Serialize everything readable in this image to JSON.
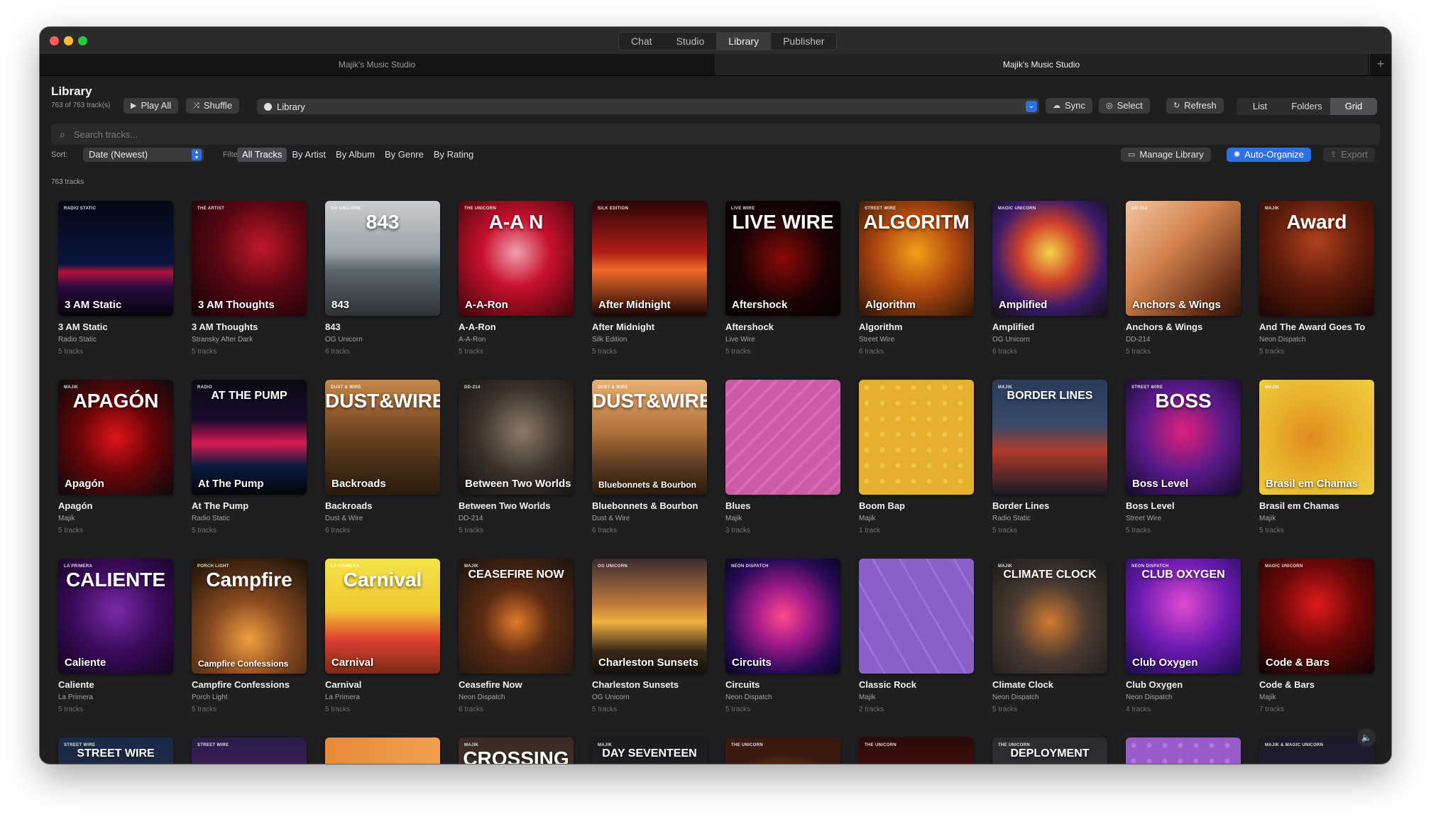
{
  "titlebar": {
    "modes": [
      "Chat",
      "Studio",
      "Library",
      "Publisher"
    ],
    "active_mode": "Library"
  },
  "doc_tabs": [
    "Majik's Music Studio",
    "Majik's Music Studio"
  ],
  "toolbar": {
    "title": "Library",
    "subtitle": "763 of 763 track(s)",
    "play_all": "Play All",
    "shuffle": "Shuffle",
    "library_select": "Library",
    "sync": "Sync",
    "select": "Select",
    "refresh": "Refresh",
    "views": [
      "List",
      "Folders",
      "Grid"
    ],
    "active_view": "Grid"
  },
  "search": {
    "placeholder": "Search tracks..."
  },
  "sort": {
    "label": "Sort:",
    "value": "Date (Newest)",
    "filter_label": "Filter",
    "filters": [
      "All Tracks",
      "By Artist",
      "By Album",
      "By Genre",
      "By Rating"
    ],
    "active_filter": "All Tracks",
    "manage_library": "Manage Library",
    "auto_organize": "Auto-Organize",
    "export": "Export"
  },
  "count_label": "763 tracks",
  "albums": [
    {
      "title": "3 AM Static",
      "artist": "Radio Static",
      "tracks": "5 tracks",
      "overlay": "3 AM Static",
      "label": "RADIO STATIC",
      "bg": "linear-gradient(180deg,#050714 0%,#0a1640 55%,#b0123a 62%,#2a0a40 75%,#05050c 100%)"
    },
    {
      "title": "3 AM Thoughts",
      "artist": "Stransky After Dark",
      "tracks": "5 tracks",
      "overlay": "3 AM Thoughts",
      "label": "THE ARTIST",
      "bg": "radial-gradient(circle at 60% 40%,#c0182a 0%,#5a0712 45%,#120205 100%)"
    },
    {
      "title": "843",
      "artist": "OG Unicorn",
      "tracks": "6 tracks",
      "overlay": "843",
      "label": "OG UNICORN",
      "big": "843",
      "bg": "linear-gradient(180deg,#c9cdd0 0%,#9aa3a8 45%,#5a666e 60%,#2e3236 100%)"
    },
    {
      "title": "A-A-Ron",
      "artist": "A-A-Ron",
      "tracks": "5 tracks",
      "overlay": "A-A-Ron",
      "label": "THE UNICORN",
      "big": "A-A N",
      "bg": "radial-gradient(circle at 50% 45%,#f0a0b0 0%,#c8102e 40%,#3a0608 100%)"
    },
    {
      "title": "After Midnight",
      "artist": "Silk Edition",
      "tracks": "5 tracks",
      "overlay": "After Midnight",
      "label": "SILK EDITION",
      "bg": "linear-gradient(180deg,#2a0408 0%,#b01e14 45%,#f06a2a 60%,#1a0404 100%)"
    },
    {
      "title": "Aftershock",
      "artist": "Live Wire",
      "tracks": "5 tracks",
      "overlay": "Aftershock",
      "label": "LIVE WIRE",
      "big": "LIVE WIRE",
      "bg": "radial-gradient(circle at 50% 50%,#8a0a0a 0%,#1a0303 55%,#050202 100%)"
    },
    {
      "title": "Algorithm",
      "artist": "Street Wire",
      "tracks": "6 tracks",
      "overlay": "Algorithm",
      "label": "STREET WIRE",
      "big": "ALGORITM",
      "bg": "radial-gradient(circle at 50% 45%,#f2a018 0%,#b44a10 45%,#2a1408 100%)"
    },
    {
      "title": "Amplified",
      "artist": "OG Unicorn",
      "tracks": "6 tracks",
      "overlay": "Amplified",
      "label": "MAGIC UNICORN",
      "bg": "radial-gradient(circle at 50% 45%,#f4d24a 0%,#d0402a 35%,#3a1a6a 65%,#121212 100%)"
    },
    {
      "title": "Anchors & Wings",
      "artist": "DD-214",
      "tracks": "5 tracks",
      "overlay": "Anchors & Wings",
      "label": "DD-214",
      "bg": "linear-gradient(135deg,#f0c5a0 0%,#d4844e 40%,#6a3018 80%,#2a1208 100%)"
    },
    {
      "title": "And The Award Goes To",
      "artist": "Neon Dispatch",
      "tracks": "5 tracks",
      "overlay": "",
      "label": "MAJIK",
      "big": "Award",
      "bg": "radial-gradient(circle at 50% 35%,#b0401e 0%,#5a1a0a 50%,#1a0604 100%)"
    },
    {
      "title": "Apagón",
      "artist": "Majik",
      "tracks": "5 tracks",
      "overlay": "Apagón",
      "label": "MAJIK",
      "big": "APAGÓN",
      "bg": "radial-gradient(circle at 50% 50%,#e0141a 0%,#6a0508 45%,#0a0a0c 100%)"
    },
    {
      "title": "At The Pump",
      "artist": "Radio Static",
      "tracks": "5 tracks",
      "overlay": "At The Pump",
      "label": "RADIO",
      "big": "AT THE PUMP",
      "bg": "linear-gradient(180deg,#0a0a12 0%,#1a0a30 35%,#d81a50 55%,#0a1a40 75%,#05050a 100%)"
    },
    {
      "title": "Backroads",
      "artist": "Dust & Wire",
      "tracks": "6 tracks",
      "overlay": "Backroads",
      "label": "DUST & WIRE",
      "big": "DUST&WIRE",
      "bg": "linear-gradient(180deg,#c88a4a 0%,#7a4a24 40%,#4a3018 70%,#2a1a0c 100%)"
    },
    {
      "title": "Between Two Worlds",
      "artist": "DD-214",
      "tracks": "5 tracks",
      "overlay": "Between Two Worlds",
      "label": "DD-214",
      "bg": "radial-gradient(circle at 55% 45%,#8a7a6a 0%,#3a3028 50%,#141210 100%)"
    },
    {
      "title": "Bluebonnets & Bourbon",
      "artist": "Dust & Wire",
      "tracks": "6 tracks",
      "overlay": "Bluebonnets & Bourbon",
      "label": "DUST & WIRE",
      "big": "DUST&WIRE",
      "bg": "linear-gradient(180deg,#e8b070 0%,#b0703a 45%,#5a3a20 75%,#2a1a0c 100%)"
    },
    {
      "title": "Blues",
      "artist": "Majik",
      "tracks": "3 tracks",
      "overlay": "",
      "label": "",
      "bg": "repeating-linear-gradient(135deg,#cc5aa8 0px,#cc5aa8 14px,#d76cb4 14px,#d76cb4 18px)"
    },
    {
      "title": "Boom Bap",
      "artist": "Majik",
      "tracks": "1 track",
      "overlay": "",
      "label": "",
      "bg": "radial-gradient(circle,#f0c64a 3px,transparent 4px) 0 0/22px 22px, #e6b02c"
    },
    {
      "title": "Border Lines",
      "artist": "Radio Static",
      "tracks": "5 tracks",
      "overlay": "",
      "label": "MAJIK",
      "big": "BORDER LINES",
      "bg": "linear-gradient(180deg,#2a3a5a 0%,#3a4a6a 40%,#b03a2a 62%,#1a1a28 100%)"
    },
    {
      "title": "Boss Level",
      "artist": "Street Wire",
      "tracks": "5 tracks",
      "overlay": "Boss Level",
      "label": "STREET WIRE",
      "big": "BOSS",
      "bg": "radial-gradient(circle at 50% 45%,#e0207a 0%,#5a1a8a 50%,#120a2a 100%)"
    },
    {
      "title": "Brasil em Chamas",
      "artist": "Majik",
      "tracks": "5 tracks",
      "overlay": "Brasil em Chamas",
      "label": "MAJIK",
      "bg": "radial-gradient(circle at 45% 50%,#e08a20 0%,#e8b028 45%,#f0d040 100%)"
    },
    {
      "title": "Caliente",
      "artist": "La Primera",
      "tracks": "5 tracks",
      "overlay": "Caliente",
      "label": "LA PRIMERA",
      "big": "CALIENTE",
      "bg": "radial-gradient(circle at 50% 45%,#7a2aa8 0%,#3a0a5a 50%,#12051e 100%)"
    },
    {
      "title": "Campfire Confessions",
      "artist": "Porch Light",
      "tracks": "5 tracks",
      "overlay": "Campfire Confessions",
      "label": "PORCH LIGHT",
      "big": "Campfire",
      "bg": "radial-gradient(circle at 50% 70%,#f0a040 0%,#8a4a20 40%,#3a2210 80%,#1a1008 100%)"
    },
    {
      "title": "Carnival",
      "artist": "La Primera",
      "tracks": "5 tracks",
      "overlay": "Carnival",
      "label": "LA PRIMERA",
      "big": "Carnival",
      "bg": "linear-gradient(180deg,#f4e24a 0%,#f0c830 45%,#e04030 70%,#7a2a18 100%)"
    },
    {
      "title": "Ceasefire Now",
      "artist": "Neon Dispatch",
      "tracks": "6 tracks",
      "overlay": "",
      "label": "MAJIK",
      "big": "CEASEFIRE NOW",
      "bg": "radial-gradient(circle at 50% 55%,#e07a2a 0%,#5a2a12 40%,#1a1410 100%)"
    },
    {
      "title": "Charleston Sunsets",
      "artist": "OG Unicorn",
      "tracks": "5 tracks",
      "overlay": "Charleston Sunsets",
      "label": "OG UNICORN",
      "bg": "linear-gradient(180deg,#3a2a30 0%,#c07a3a 40%,#f0b040 55%,#3a2a1a 80%,#141008 100%)"
    },
    {
      "title": "Circuits",
      "artist": "Neon Dispatch",
      "tracks": "5 tracks",
      "overlay": "Circuits",
      "label": "NEON DISPATCH",
      "bg": "radial-gradient(circle at 50% 50%,#ff4a8a 0%,#a01a8a 35%,#2a0a5a 70%,#0a0520 100%)"
    },
    {
      "title": "Classic Rock",
      "artist": "Majik",
      "tracks": "2 tracks",
      "overlay": "",
      "label": "",
      "bg": "repeating-linear-gradient(60deg,#8a60c8 0px,#8a60c8 30px,#9a74d4 30px,#9a74d4 33px)"
    },
    {
      "title": "Climate Clock",
      "artist": "Neon Dispatch",
      "tracks": "5 tracks",
      "overlay": "",
      "label": "MAJIK",
      "big": "CLIMATE CLOCK",
      "bg": "radial-gradient(circle at 50% 55%,#d07a30 0%,#4a3a30 45%,#1a1a1c 100%)"
    },
    {
      "title": "Club Oxygen",
      "artist": "Neon Dispatch",
      "tracks": "4 tracks",
      "overlay": "Club Oxygen",
      "label": "NEON DISPATCH",
      "big": "CLUB OXYGEN",
      "bg": "radial-gradient(circle at 50% 40%,#e04ad0 0%,#6a1ab0 50%,#1a0a4a 100%)"
    },
    {
      "title": "Code & Bars",
      "artist": "Majik",
      "tracks": "7 tracks",
      "overlay": "Code & Bars",
      "label": "MAGIC UNICORN",
      "bg": "radial-gradient(circle at 50% 40%,#e01a1a 0%,#6a0808 45%,#120404 100%)"
    },
    {
      "title": "",
      "artist": "",
      "tracks": "",
      "overlay": "",
      "label": "STREET WIRE",
      "big": "STREET WIRE",
      "bg": "linear-gradient(180deg,#1a2a4a 0%,#2a2a3a 100%)"
    },
    {
      "title": "",
      "artist": "",
      "tracks": "",
      "overlay": "",
      "label": "STREET WIRE",
      "bg": "linear-gradient(180deg,#2a1a4a 0%,#6a2a6a 100%)"
    },
    {
      "title": "",
      "artist": "",
      "tracks": "",
      "overlay": "",
      "label": "",
      "bg": "linear-gradient(90deg,#e88a3a 0%,#f0a050 100%)"
    },
    {
      "title": "",
      "artist": "",
      "tracks": "",
      "overlay": "",
      "label": "MAJIK",
      "big": "CROSSING",
      "bg": "linear-gradient(180deg,#3a2a24 0%,#5a4434 100%)"
    },
    {
      "title": "",
      "artist": "",
      "tracks": "",
      "overlay": "",
      "label": "MAJIK",
      "big": "DAY SEVENTEEN",
      "bg": "linear-gradient(180deg,#1a1a20 0%,#3a3030 100%)"
    },
    {
      "title": "",
      "artist": "",
      "tracks": "",
      "overlay": "",
      "label": "THE UNICORN",
      "bg": "radial-gradient(circle at 50% 80%,#e08a2a 0%,#3a1a10 70%)"
    },
    {
      "title": "",
      "artist": "",
      "tracks": "",
      "overlay": "",
      "label": "THE UNICORN",
      "bg": "linear-gradient(180deg,#2a0a08 0%,#7a1a10 100%)"
    },
    {
      "title": "",
      "artist": "",
      "tracks": "",
      "overlay": "",
      "label": "THE UNICORN",
      "big": "DEPLOYMENT",
      "bg": "linear-gradient(180deg,#2a2a30 0%,#4a3a3a 100%)"
    },
    {
      "title": "",
      "artist": "",
      "tracks": "",
      "overlay": "",
      "label": "",
      "bg": "radial-gradient(circle,#b07ad8 3px,transparent 4px) 0 0/22px 22px, #9a5ac8"
    },
    {
      "title": "",
      "artist": "",
      "tracks": "",
      "overlay": "",
      "label": "MAJIK & MAGIC UNICORN",
      "bg": "linear-gradient(180deg,#1a1a2a 0%,#2a2a3a 100%)"
    }
  ],
  "volume_icon": "speaker-icon"
}
